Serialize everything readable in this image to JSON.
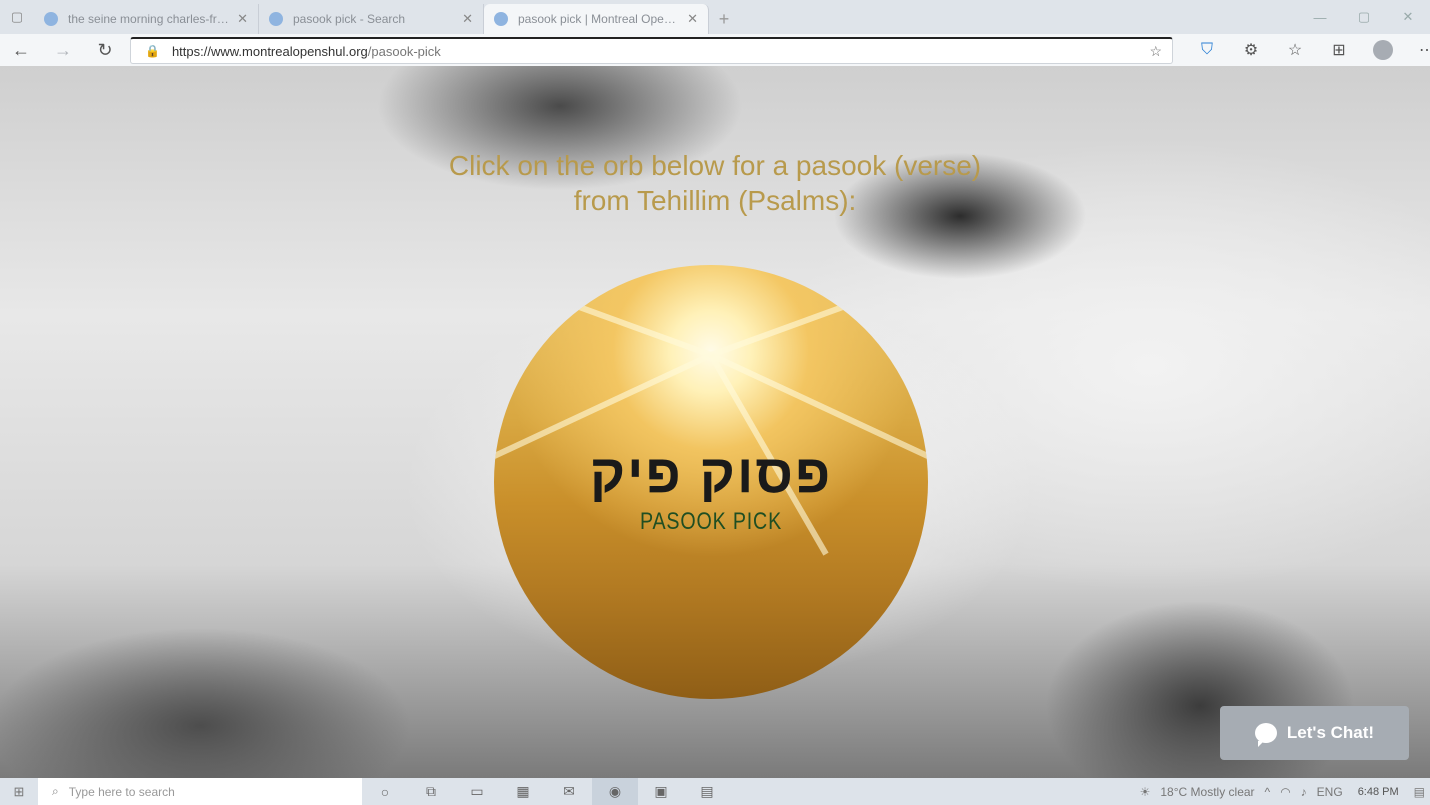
{
  "browser": {
    "tabs": [
      {
        "title": "the seine morning charles-franc",
        "active": false
      },
      {
        "title": "pasook pick - Search",
        "active": false
      },
      {
        "title": "pasook pick | Montreal Open Shul",
        "active": true
      }
    ],
    "new_tab_label": "+",
    "address": {
      "host": "https://www.montrealopenshul.org",
      "path": "/pasook-pick"
    }
  },
  "page": {
    "headline_line1": "Click on the orb below for a pasook (verse)",
    "headline_line2": "from Tehillim (Psalms):",
    "orb_hebrew": "פסוק פיק",
    "orb_subtitle": "PASOOK PICK",
    "chat_button": "Let's Chat!"
  },
  "taskbar": {
    "search_placeholder": "Type here to search",
    "weather": "18°C  Mostly clear",
    "language": "ENG",
    "time": "6:48 PM"
  },
  "colors": {
    "headline": "#b89a4c",
    "orb_subtitle": "#1f4e22",
    "chat_bg": "#a6acb3"
  }
}
